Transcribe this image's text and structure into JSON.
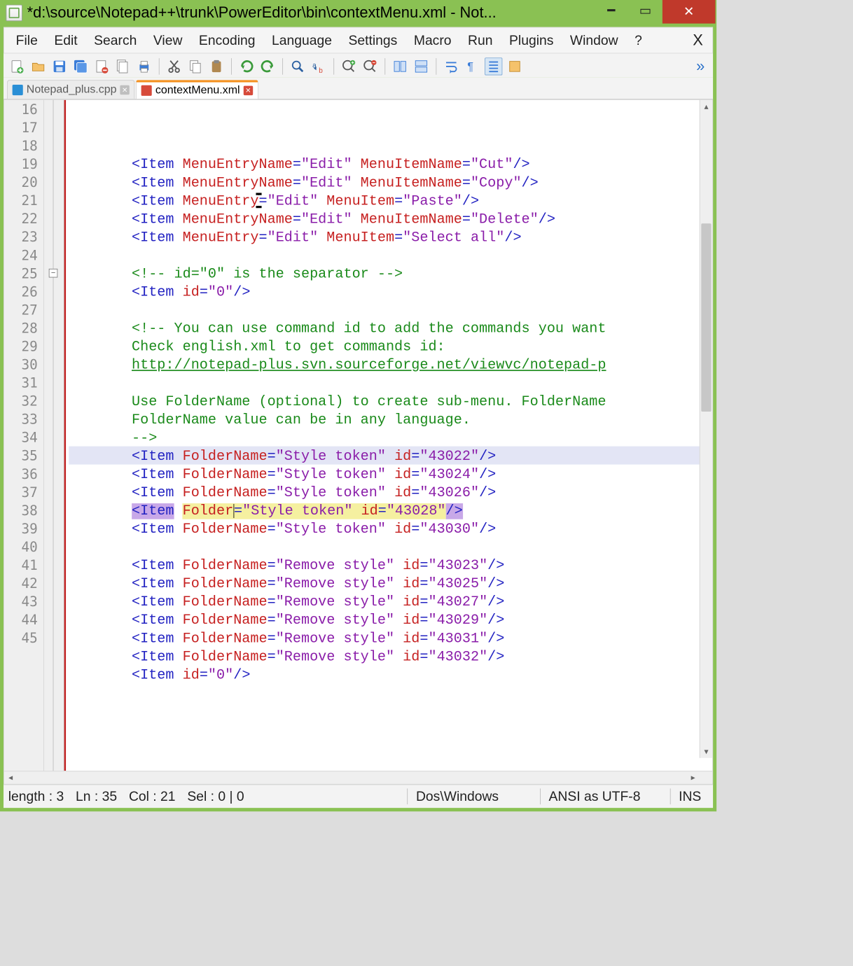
{
  "title": "*d:\\source\\Notepad++\\trunk\\PowerEditor\\bin\\contextMenu.xml - Not...",
  "menus": [
    "File",
    "Edit",
    "Search",
    "View",
    "Encoding",
    "Language",
    "Settings",
    "Macro",
    "Run",
    "Plugins",
    "Window",
    "?"
  ],
  "tabs": [
    {
      "label": "Notepad_plus.cpp",
      "active": false,
      "icon": "blue"
    },
    {
      "label": "contextMenu.xml",
      "active": true,
      "icon": "red"
    }
  ],
  "line_start": 16,
  "line_end": 45,
  "status": {
    "lengthLabel": "length : 3",
    "lnLabel": "Ln : 35",
    "colLabel": "Col : 21",
    "selLabel": "Sel : 0 | 0",
    "eol": "Dos\\Windows",
    "encoding": "ANSI as UTF-8",
    "ins": "INS"
  },
  "code": {
    "l16": {
      "attr1": "MenuEntryName",
      "val1": "Edit",
      "attr2": "MenuItemName",
      "val2": "Cut"
    },
    "l17": {
      "attr1": "MenuEntryName",
      "val1": "Edit",
      "attr2": "MenuItemName",
      "val2": "Copy"
    },
    "l18": {
      "attr1": "MenuEntry",
      "val1": "Edit",
      "attr2": "MenuItem",
      "val2": "Paste"
    },
    "l19": {
      "attr1": "MenuEntryName",
      "val1": "Edit",
      "attr2": "MenuItemName",
      "val2": "Delete"
    },
    "l20": {
      "attr1": "MenuEntry",
      "val1": "Edit",
      "attr2": "MenuItem",
      "val2": "Select all"
    },
    "l22": "<!-- id=\"0\" is the separator -->",
    "l23_id": "0",
    "l25": "<!-- You can use command id to add the commands you want",
    "l26": "Check english.xml to get commands id:",
    "l27": "http://notepad-plus.svn.sourceforge.net/viewvc/notepad-p",
    "l29": "Use FolderName (optional) to create sub-menu. FolderName",
    "l30": "FolderName value can be in any language.",
    "l31": "-->",
    "style_items": [
      {
        "id": "43022"
      },
      {
        "id": "43024"
      },
      {
        "id": "43026"
      },
      {
        "id": "43028"
      },
      {
        "id": "43030"
      }
    ],
    "style_label": "Style token",
    "remove_items": [
      {
        "id": "43023"
      },
      {
        "id": "43025"
      },
      {
        "id": "43027"
      },
      {
        "id": "43029"
      },
      {
        "id": "43031"
      },
      {
        "id": "43032"
      }
    ],
    "remove_label": "Remove style",
    "folder_attr": "FolderName",
    "folder_attr_changed": "Folder",
    "item_tag": "Item",
    "id_attr": "id",
    "l35_attr": "Folder",
    "l35_val": "Style token",
    "l35_id": "43028"
  }
}
